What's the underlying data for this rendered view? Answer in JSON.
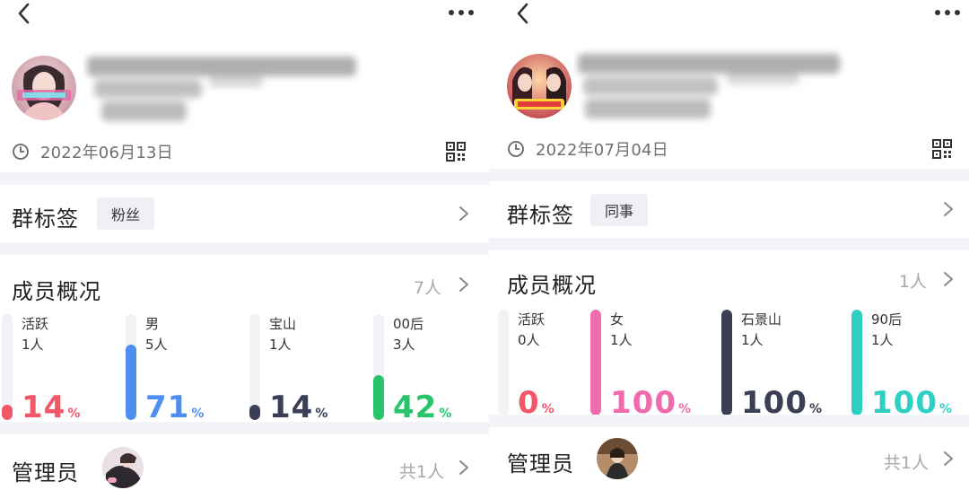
{
  "screens": [
    {
      "created_date": "2022年06月13日",
      "tags_title": "群标签",
      "tag_label": "粉丝",
      "overview_title": "成员概况",
      "member_count": "7人",
      "stats": [
        {
          "label": "活跃",
          "count": "1人",
          "percent": "14",
          "unit": "%",
          "color": "#f0586a",
          "fill": 0.14
        },
        {
          "label": "男",
          "count": "5人",
          "percent": "71",
          "unit": "%",
          "color": "#4d8ef0",
          "fill": 0.71
        },
        {
          "label": "宝山",
          "count": "1人",
          "percent": "14",
          "unit": "%",
          "color": "#3a3f55",
          "fill": 0.14
        },
        {
          "label": "00后",
          "count": "3人",
          "percent": "42",
          "unit": "%",
          "color": "#27c46a",
          "fill": 0.42
        }
      ],
      "admin_title": "管理员",
      "admin_count": "共1人"
    },
    {
      "created_date": "2022年07月04日",
      "tags_title": "群标签",
      "tag_label": "同事",
      "overview_title": "成员概况",
      "member_count": "1人",
      "stats": [
        {
          "label": "活跃",
          "count": "0人",
          "percent": "0",
          "unit": "%",
          "color": "#f0586a",
          "fill": 0.0
        },
        {
          "label": "女",
          "count": "1人",
          "percent": "100",
          "unit": "%",
          "color": "#f06aae",
          "fill": 1.0
        },
        {
          "label": "石景山",
          "count": "1人",
          "percent": "100",
          "unit": "%",
          "color": "#3a3f55",
          "fill": 1.0
        },
        {
          "label": "90后",
          "count": "1人",
          "percent": "100",
          "unit": "%",
          "color": "#2fd0c3",
          "fill": 1.0
        }
      ],
      "admin_title": "管理员",
      "admin_count": "共1人"
    }
  ],
  "icons": {
    "back": "chevron-left-icon",
    "more": "more-horizontal-icon",
    "clock": "clock-icon",
    "qr": "qr-code-icon",
    "chevron": "chevron-right-icon"
  }
}
